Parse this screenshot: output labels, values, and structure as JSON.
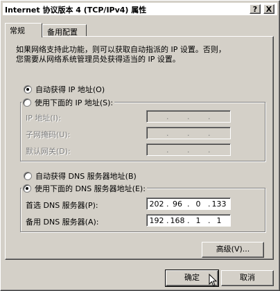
{
  "window": {
    "title": "Internet 协议版本 4 (TCP/IPv4) 属性",
    "help_label": "?",
    "close_label": "X"
  },
  "tabs": [
    {
      "label": "常规",
      "active": true
    },
    {
      "label": "备用配置",
      "active": false
    }
  ],
  "intro": {
    "line1": "如果网络支持此功能，则可以获取自动指派的 IP 设置。否则，",
    "line2": "您需要从网络系统管理员处获得适当的 IP 设置。"
  },
  "ip_section": {
    "auto_label": "自动获得 IP 地址(O)",
    "auto_checked": true,
    "manual_label": "使用下面的 IP 地址(S):",
    "manual_checked": false,
    "fields": [
      {
        "label": "IP 地址(I):",
        "octets": [
          "",
          "",
          "",
          ""
        ]
      },
      {
        "label": "子网掩码(U):",
        "octets": [
          "",
          "",
          "",
          ""
        ]
      },
      {
        "label": "默认网关(D):",
        "octets": [
          "",
          "",
          "",
          ""
        ]
      }
    ]
  },
  "dns_section": {
    "auto_label": "自动获得 DNS 服务器地址(B)",
    "auto_checked": false,
    "manual_label": "使用下面的 DNS 服务器地址(E):",
    "manual_checked": true,
    "fields": [
      {
        "label": "首选 DNS 服务器(P):",
        "octets": [
          "202",
          "96",
          "0",
          "133"
        ]
      },
      {
        "label": "备用 DNS 服务器(A):",
        "octets": [
          "192",
          "168",
          "1",
          "1"
        ]
      }
    ]
  },
  "buttons": {
    "advanced": "高级(V)...",
    "ok": "确定",
    "cancel": "取消"
  }
}
